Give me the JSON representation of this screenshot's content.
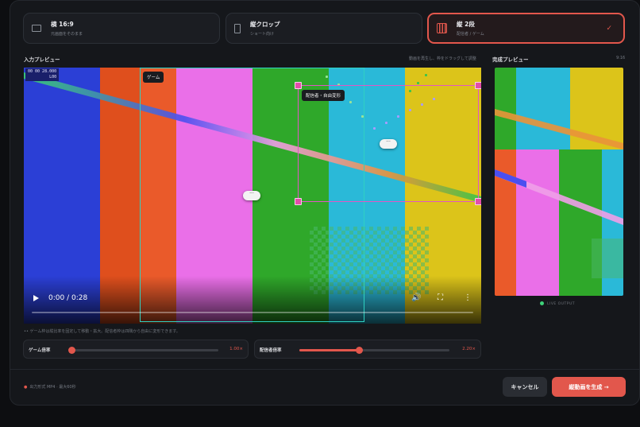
{
  "modes": [
    {
      "title": "横 16:9",
      "sub": "元画面をそのまま",
      "icon": "landscape-frame-icon"
    },
    {
      "title": "縦クロップ",
      "sub": "ショート向け",
      "icon": "portrait-frame-icon"
    },
    {
      "title": "縦 2段",
      "sub": "配信者 / ゲーム",
      "icon": "stacked-columns-icon",
      "check": "✓"
    }
  ],
  "input": {
    "title": "入力プレビュー",
    "hint": "動画を再生し、枠をドラッグして調整",
    "timecode_line1": "00 00 28.000",
    "timecode_line2": "L00",
    "game_label": "ゲーム",
    "streamer_label": "配信者・自由変形",
    "drag_glyph": "···",
    "time": "0:00 / 0:28",
    "volume_glyph": "🔊",
    "fullscreen_glyph": "⛶",
    "more_glyph": "⋮",
    "progress": 0.0,
    "note": "•• ゲーム枠は縦比率を固定して移動・拡大。配信者枠は四隅から自由に変形できます。"
  },
  "output": {
    "title": "完成プレビュー",
    "hint": "9:16",
    "live": "LIVE OUTPUT"
  },
  "sliders": [
    {
      "label": "ゲーム倍率",
      "value": "1.00×",
      "fraction": 0.0
    },
    {
      "label": "配信者倍率",
      "value": "2.20×",
      "fraction": 0.4
    }
  ],
  "footer": {
    "note_dot": "●",
    "note": "出力形式 MP4 · 最大60秒",
    "cancel": "キャンセル",
    "generate": "縦動画を生成 →"
  },
  "colors": {
    "accent": "#e2574c",
    "game_frame": "#2fd1c2",
    "streamer_frame": "#e256c4",
    "stripes": [
      "#2b3fd6",
      "#df4f1d",
      "#ea5a2a",
      "#ea6fe8",
      "#2fa82a",
      "#2ab9d8",
      "#dcc41a"
    ]
  }
}
